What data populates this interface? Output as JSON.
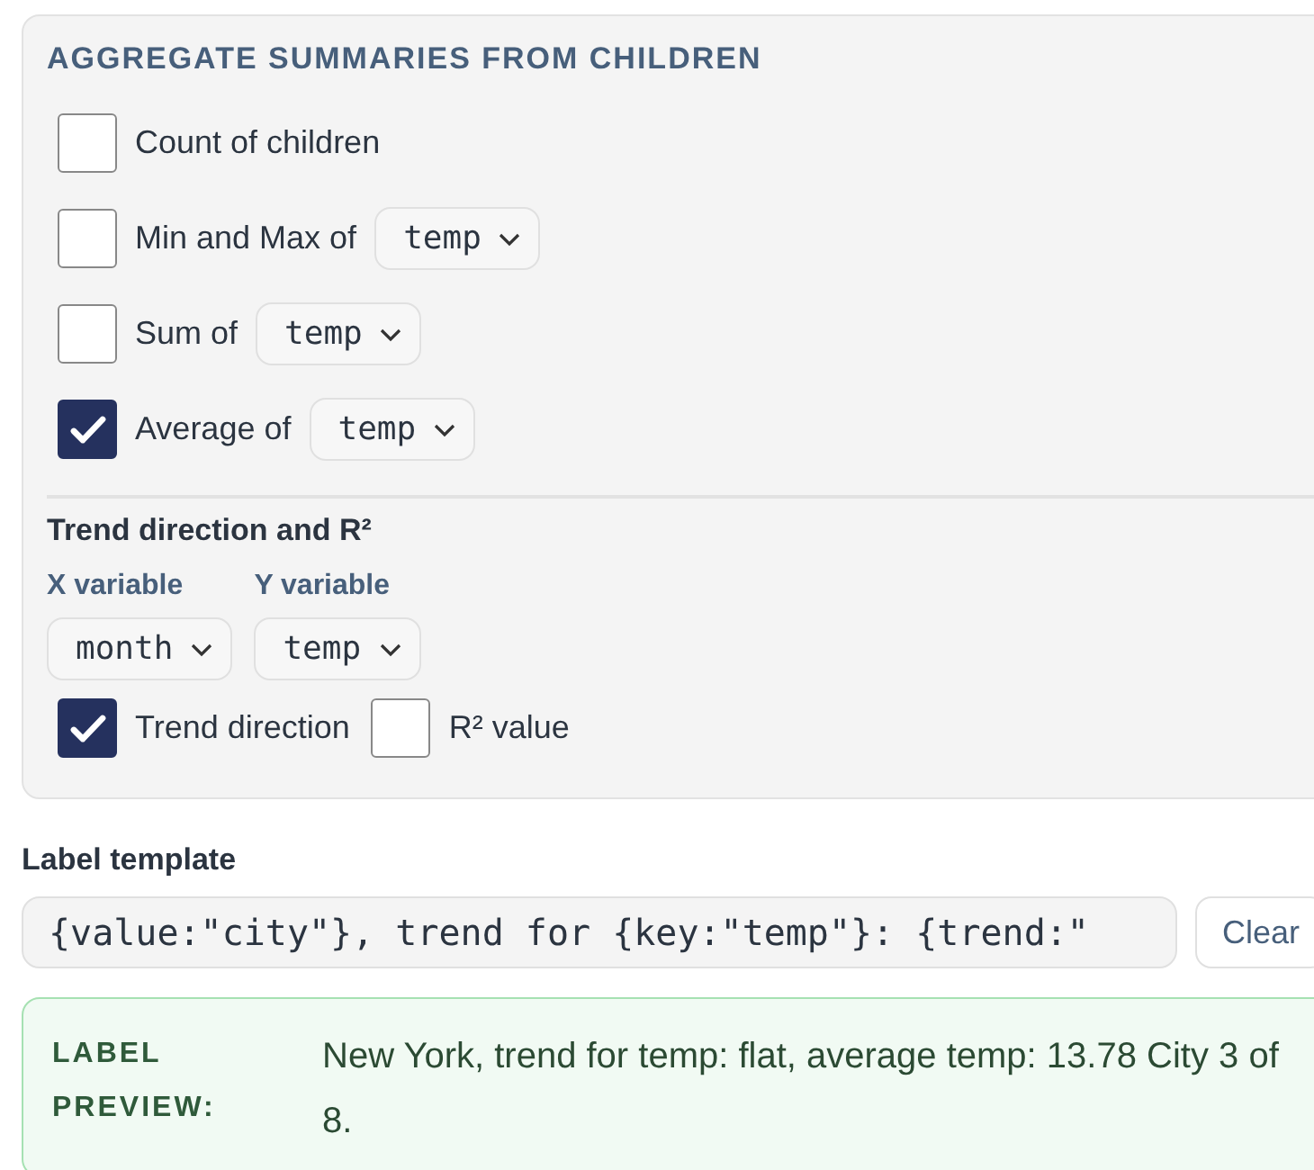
{
  "summaries": {
    "title": "AGGREGATE SUMMARIES FROM CHILDREN",
    "items": [
      {
        "label": "Count of children",
        "checked": false
      },
      {
        "label": "Min and Max of",
        "checked": false,
        "field": "temp"
      },
      {
        "label": "Sum of",
        "checked": false,
        "field": "temp"
      },
      {
        "label": "Average of",
        "checked": true,
        "field": "temp"
      }
    ]
  },
  "trend": {
    "title": "Trend direction and R²",
    "x_label": "X variable",
    "y_label": "Y variable",
    "x_field": "month",
    "y_field": "temp",
    "options": [
      {
        "label": "Trend direction",
        "checked": true
      },
      {
        "label": "R² value",
        "checked": false
      }
    ]
  },
  "template": {
    "label": "Label template",
    "value": "{value:\"city\"}, trend for {key:\"temp\"}: {trend:\"",
    "clear_button": "Clear"
  },
  "preview": {
    "label": "LABEL PREVIEW:",
    "text": "New York, trend for temp: flat, average temp: 13.78 City 3 of 8."
  }
}
